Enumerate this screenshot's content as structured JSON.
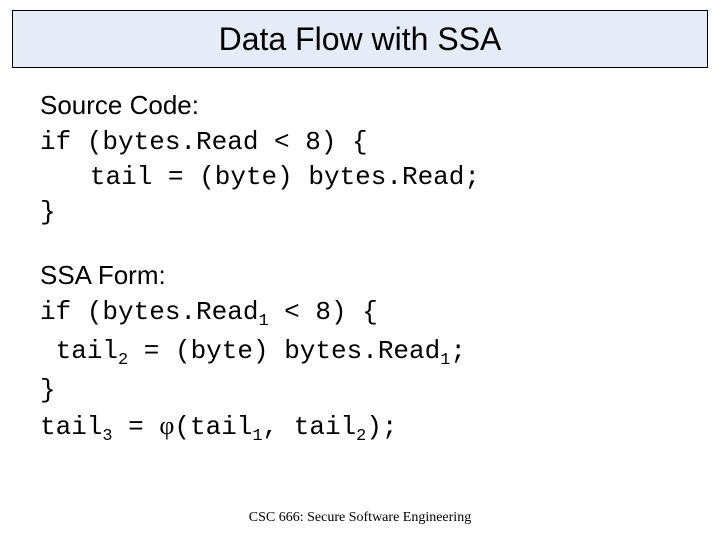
{
  "slide": {
    "title": "Data Flow with SSA",
    "source_label": "Source Code:",
    "source_code": {
      "line1_a": "if (bytes.Read < 8) {",
      "line2_a": "tail = (byte) bytes.Read;",
      "line3_a": "}"
    },
    "ssa_label": "SSA Form:",
    "ssa_code": {
      "if_kw": "if (bytes.Read",
      "sub1a": "1",
      "if_rest": " < 8) {",
      "tail_a": "tail",
      "sub2a": "2",
      "tail_mid": " = (byte) bytes.Read",
      "sub1b": "1",
      "tail_end": ";",
      "close": "}",
      "phi_tail": "tail",
      "sub3": "3",
      "phi_eq": " = ",
      "phi_sym": "φ",
      "phi_open": "(tail",
      "sub1c": "1",
      "phi_comma": ", tail",
      "sub2b": "2",
      "phi_close": ");"
    },
    "footer": "CSC 666: Secure Software Engineering"
  }
}
